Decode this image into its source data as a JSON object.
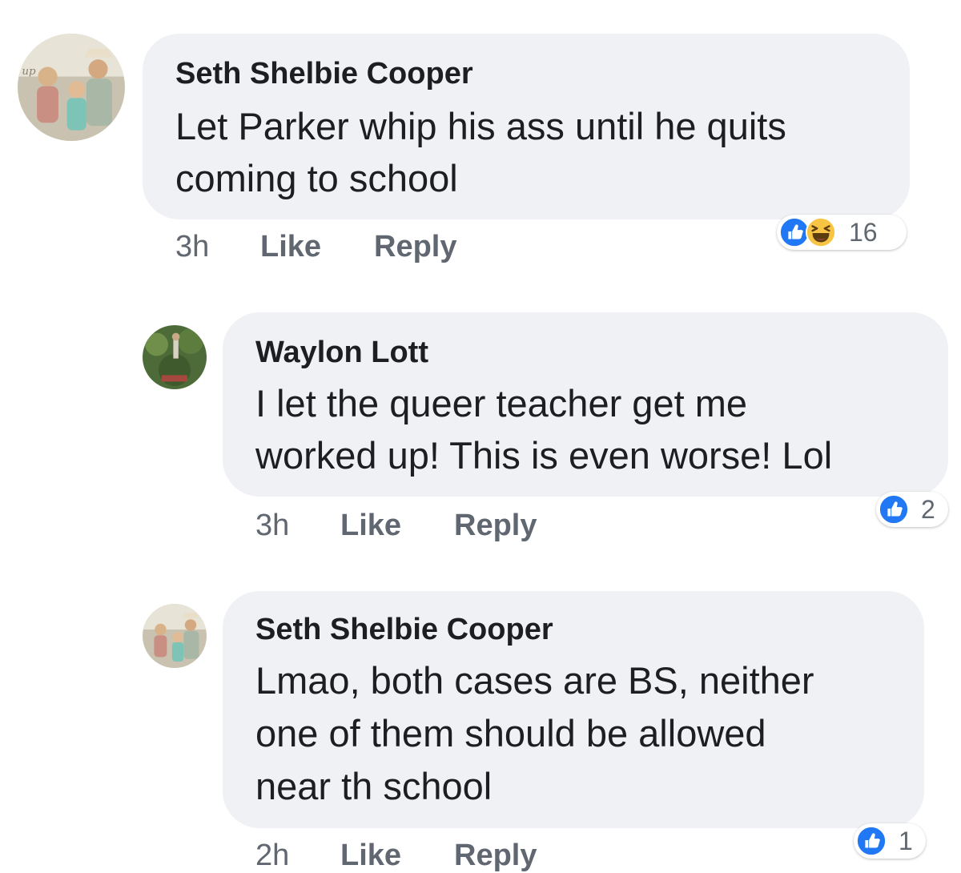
{
  "comments": [
    {
      "author": "Seth Shelbie Cooper",
      "lines": [
        "Let Parker whip his ass until he quits",
        "coming to school"
      ],
      "time": "3h",
      "like_label": "Like",
      "reply_label": "Reply",
      "reactions": [
        "like-icon",
        "haha-icon"
      ],
      "reaction_count": "16"
    },
    {
      "author": "Waylon Lott",
      "lines": [
        "I let the queer teacher get me",
        "worked up! This is even worse! Lol"
      ],
      "time": "3h",
      "like_label": "Like",
      "reply_label": "Reply",
      "reactions": [
        "like-icon"
      ],
      "reaction_count": "2"
    },
    {
      "author": "Seth Shelbie Cooper",
      "lines": [
        "Lmao, both cases are BS, neither",
        "one of them should be allowed",
        "near th school"
      ],
      "time": "2h",
      "like_label": "Like",
      "reply_label": "Reply",
      "reactions": [
        "like-icon"
      ],
      "reaction_count": "1"
    }
  ],
  "colors": {
    "bubble": "#eff1f4",
    "like_blue": "#2078f4",
    "haha_yellow": "#f7c444",
    "meta_gray": "#606770",
    "text": "#1c1e21"
  }
}
